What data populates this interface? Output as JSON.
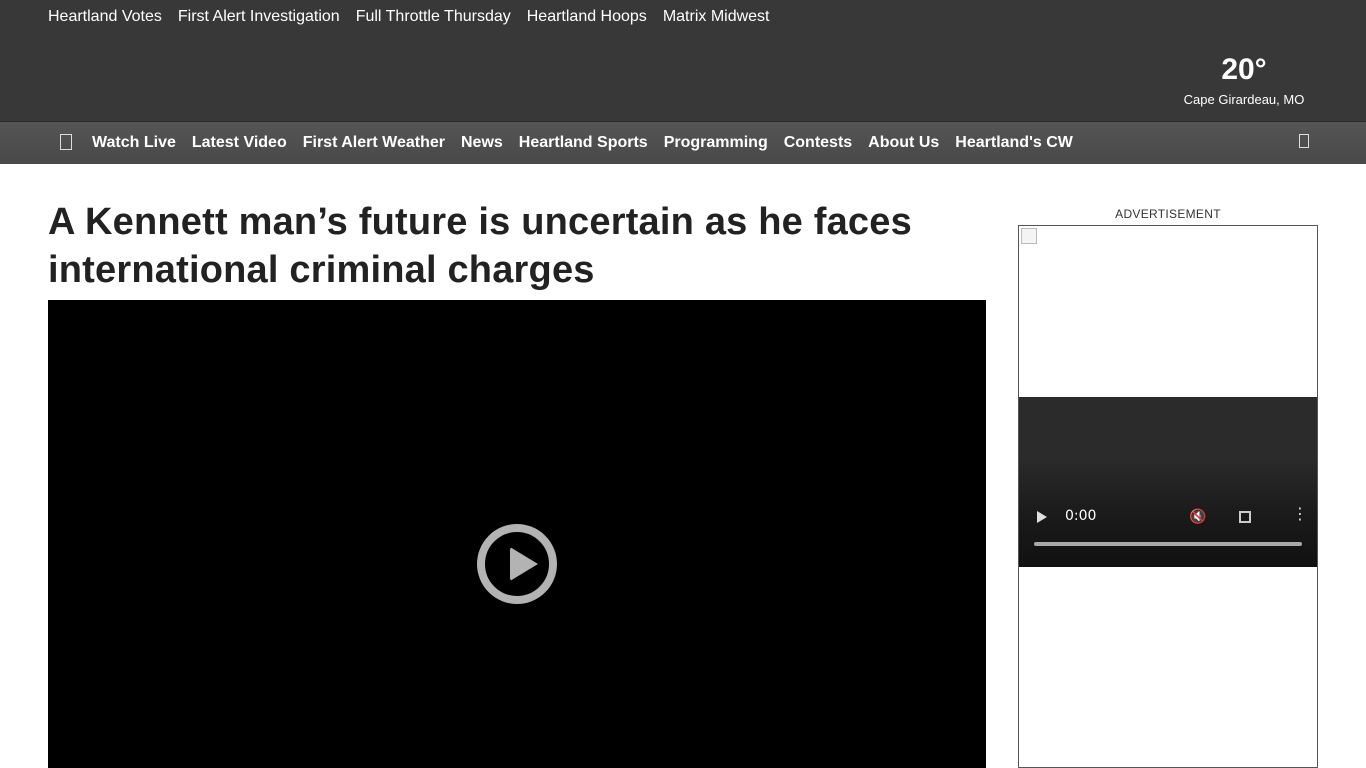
{
  "top_links": [
    "Heartland Votes",
    "First Alert Investigation",
    "Full Throttle Thursday",
    "Heartland Hoops",
    "Matrix Midwest"
  ],
  "weather": {
    "temperature": "20°",
    "location": "Cape Girardeau, MO"
  },
  "nav": {
    "menu_icon": "menu-icon",
    "items": [
      "Watch Live",
      "Latest Video",
      "First Alert Weather",
      "News",
      "Heartland Sports",
      "Programming",
      "Contests",
      "About Us",
      "Heartland's CW"
    ],
    "search_icon": "search-icon"
  },
  "article": {
    "headline": "A Kennett man’s future is uncertain as he faces international criminal charges"
  },
  "ad": {
    "label": "ADVERTISEMENT",
    "video_time": "0:00",
    "mute_glyph": "🔇",
    "more_glyph": "⋮"
  },
  "colors": {
    "header_bg": "#383838",
    "nav_bg": "#4f4f4f",
    "video_bg": "#000000",
    "play_button": "#b3b3b3"
  }
}
